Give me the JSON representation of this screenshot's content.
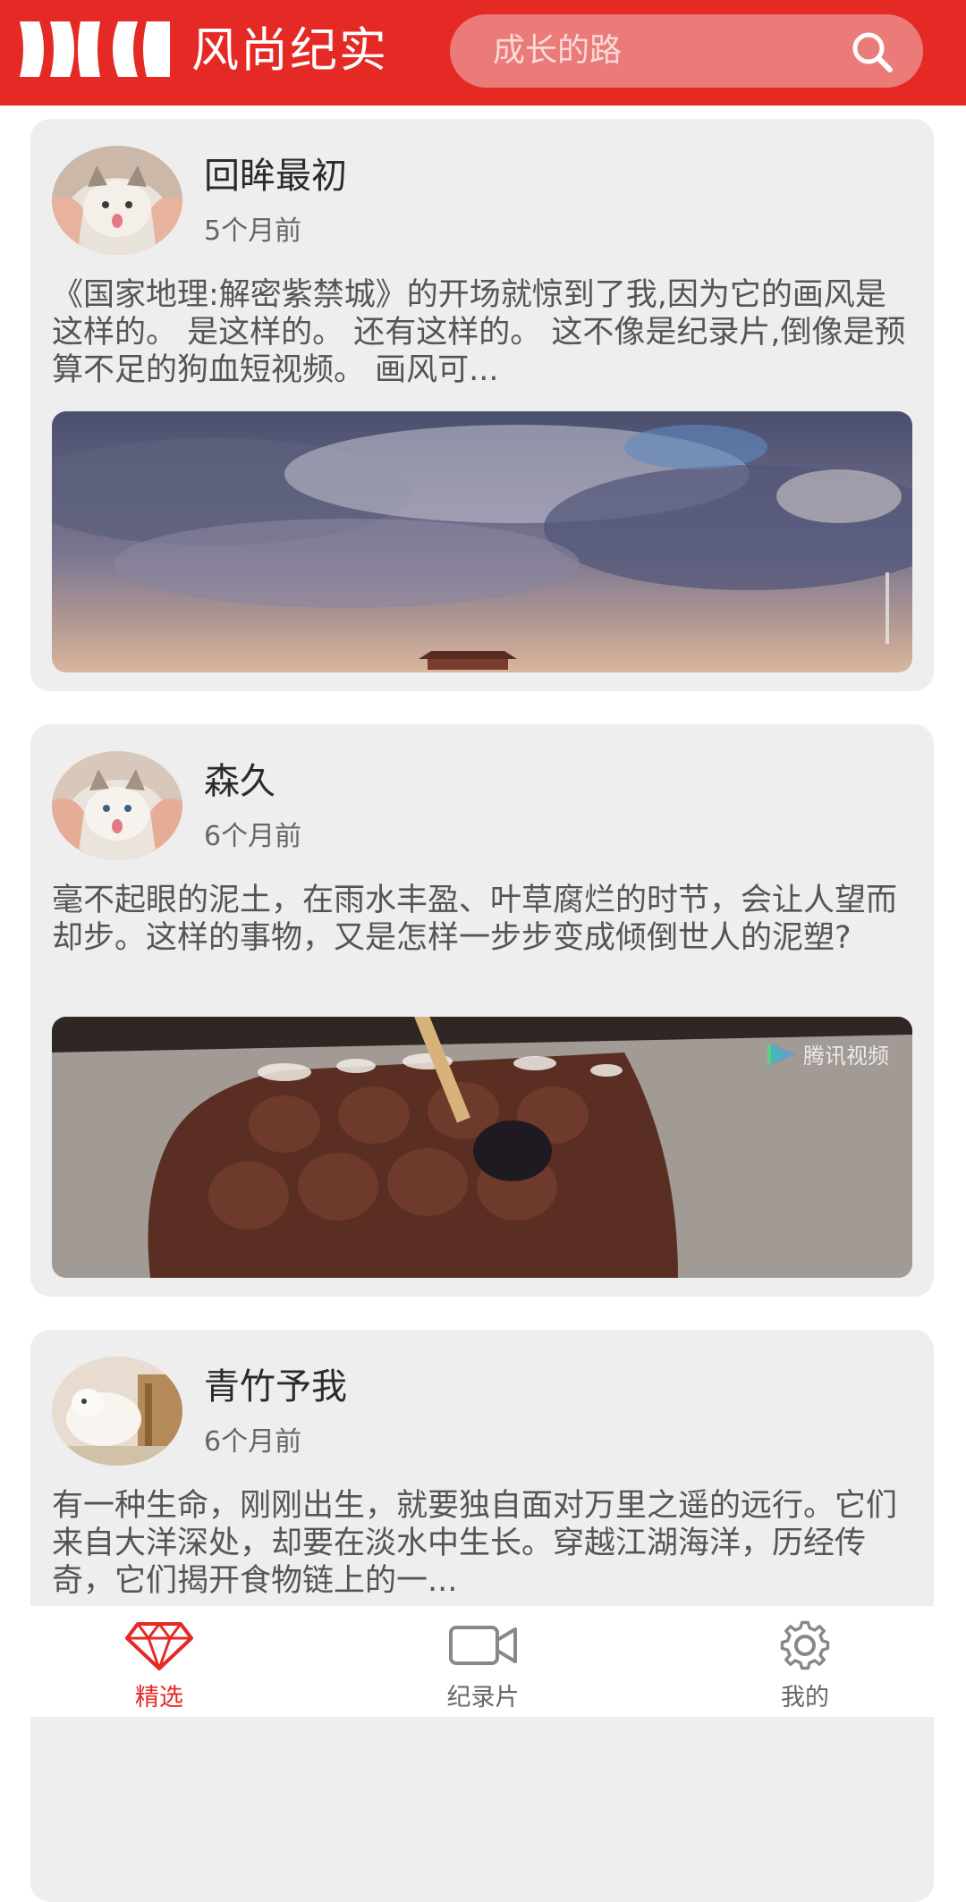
{
  "header": {
    "title": "风尚纪实",
    "search_placeholder": "成长的路",
    "search_icon": "search-icon"
  },
  "feed": [
    {
      "author": "回眸最初",
      "time": "5个月前",
      "summary": "《国家地理:解密紫禁城》的开场就惊到了我,因为它的画风是这样的。 是这样的。 还有这样的。 这不像是纪录片,倒像是预算不足的狗血短视频。 画风可..."
    },
    {
      "author": "森久",
      "time": "6个月前",
      "summary": "毫不起眼的泥土，在雨水丰盈、叶草腐烂的时节，会让人望而却步。这样的事物，又是怎样一步步变成倾倒世人的泥塑?"
    },
    {
      "author": "青竹予我",
      "time": "6个月前",
      "summary": "有一种生命，刚刚出生，就要独自面对万里之遥的远行。它们来自大洋深处，却要在淡水中生长。穿越江湖海洋，历经传奇，它们揭开食物链上的一..."
    }
  ],
  "bottom_nav": [
    {
      "label": "精选",
      "icon": "diamond-icon",
      "active": true
    },
    {
      "label": "纪录片",
      "icon": "video-camera-icon",
      "active": false
    },
    {
      "label": "我的",
      "icon": "gear-icon",
      "active": false
    }
  ],
  "colors": {
    "brand_red": "#e52a26",
    "card_bg": "#eeeeee"
  }
}
